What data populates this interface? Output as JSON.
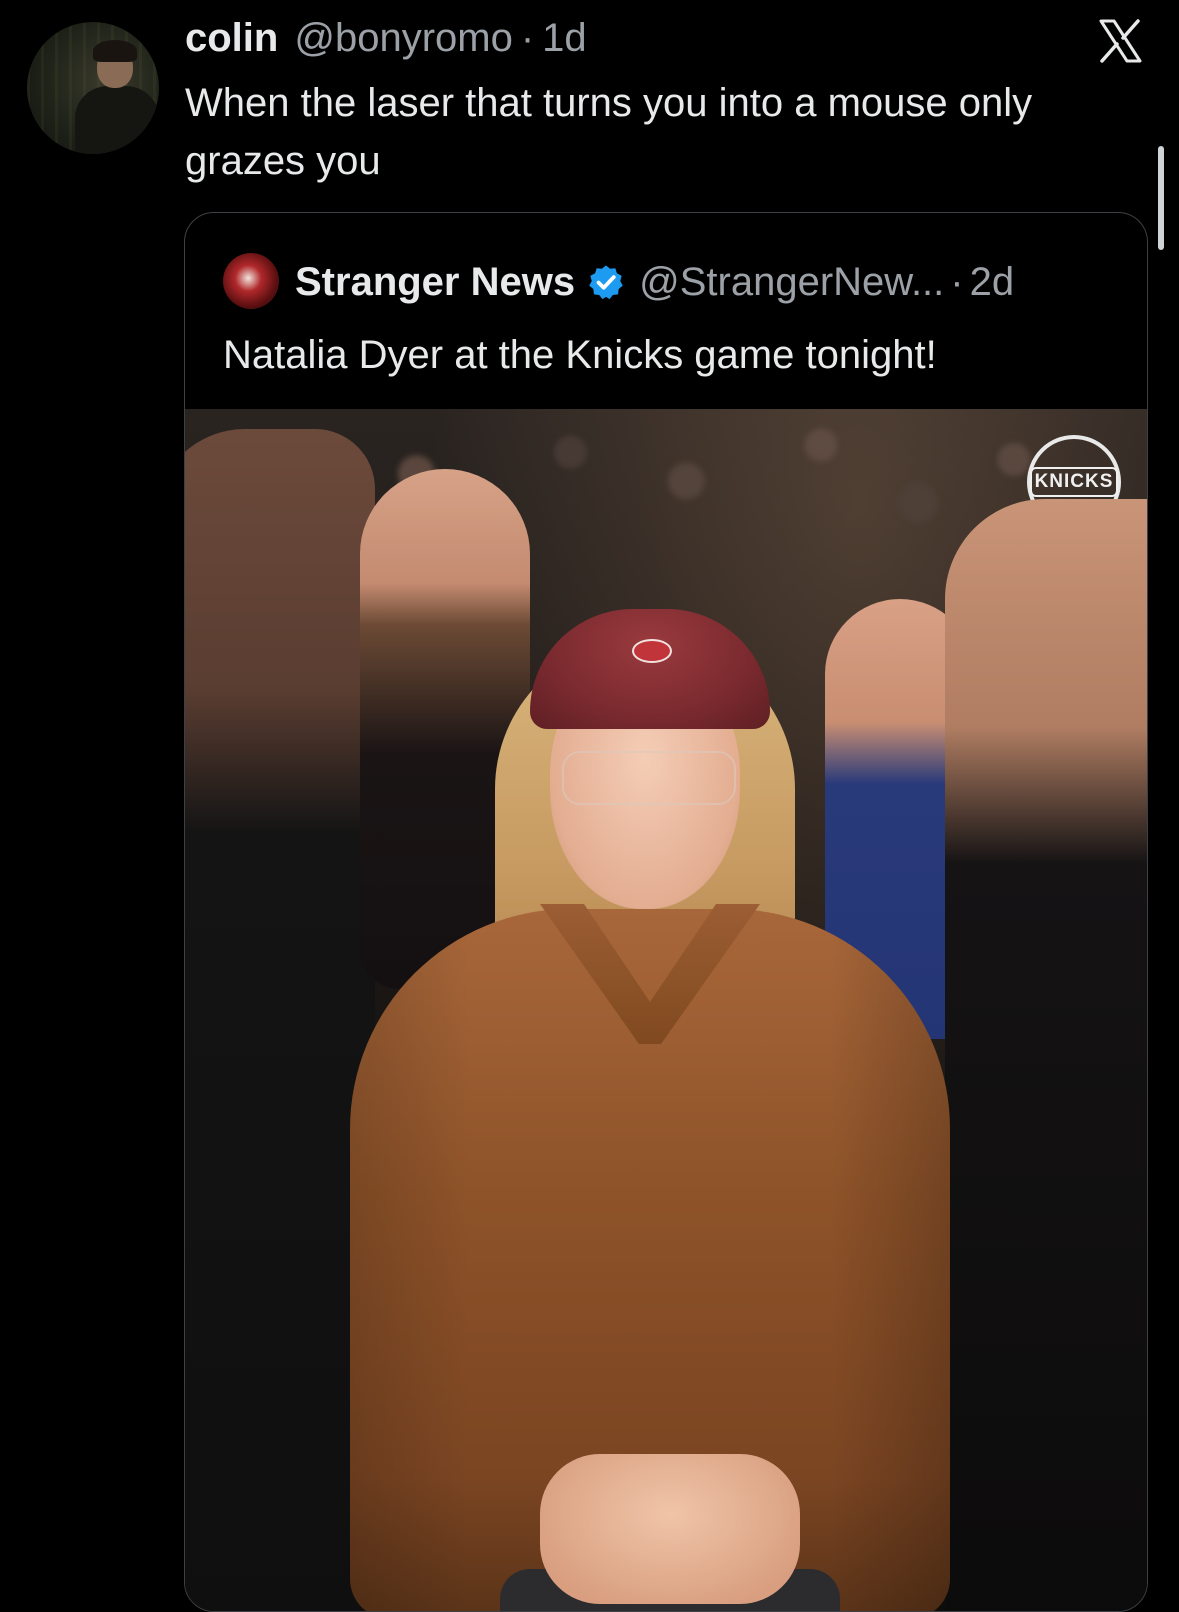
{
  "tweet": {
    "author_name": "colin",
    "author_handle": "@bonyromo",
    "separator": "·",
    "time": "1d",
    "text": "When the laser that turns you into a mouse only grazes you",
    "brand_icon": "x-logo-icon"
  },
  "quoted_tweet": {
    "author_name": "Stranger News",
    "verified": true,
    "verified_color": "#1d9bf0",
    "author_handle": "@StrangerNew...",
    "separator": "·",
    "time": "2d",
    "text": "Natalia Dyer at the Knicks game tonight!",
    "photo": {
      "badge_text": "KNICKS"
    }
  },
  "colors": {
    "background": "#000000",
    "primary_text": "#e7e9ea",
    "secondary_text": "#9ba1a6",
    "quote_border": "#3d4146"
  }
}
